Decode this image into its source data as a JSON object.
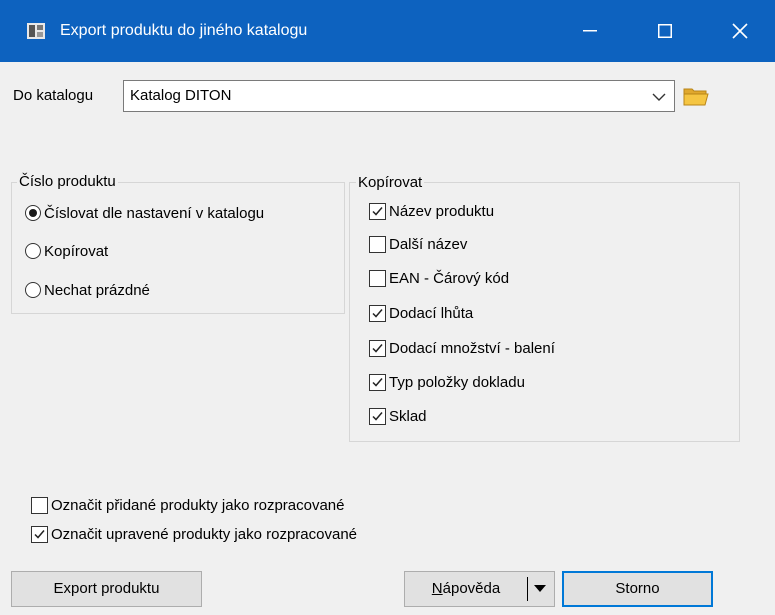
{
  "window": {
    "title": "Export produktu do jiného katalogu",
    "icon": "catalog-app-icon"
  },
  "target": {
    "label": "Do katalogu",
    "value": "Katalog DITON",
    "arrow_icon": "chevron-down-icon",
    "browse_icon": "folder-open-icon"
  },
  "cislo": {
    "title": "Číslo produktu",
    "options": [
      {
        "label": "Číslovat dle nastavení v katalogu",
        "selected": true
      },
      {
        "label": "Kopírovat",
        "selected": false
      },
      {
        "label": "Nechat prázdné",
        "selected": false
      }
    ]
  },
  "kopirovat": {
    "title": "Kopírovat",
    "items": [
      {
        "label": "Název produktu",
        "checked": true
      },
      {
        "label": "Další název",
        "checked": false
      },
      {
        "label": "EAN - Čárový kód",
        "checked": false
      },
      {
        "label": "Dodací lhůta",
        "checked": true
      },
      {
        "label": "Dodací množství - balení",
        "checked": true
      },
      {
        "label": "Typ položky dokladu",
        "checked": true
      },
      {
        "label": "Sklad",
        "checked": true
      }
    ]
  },
  "flags": [
    {
      "label": "Označit přidané produkty jako rozpracované",
      "checked": false
    },
    {
      "label": "Označit upravené produkty jako rozpracované",
      "checked": true
    }
  ],
  "buttons": {
    "export": "Export produktu",
    "help_first": "N",
    "help_rest": "ápověda",
    "cancel": "Storno"
  },
  "colors": {
    "titlebar": "#0d62bf",
    "focus_border": "#0078d7",
    "folder": "#f5c542"
  }
}
